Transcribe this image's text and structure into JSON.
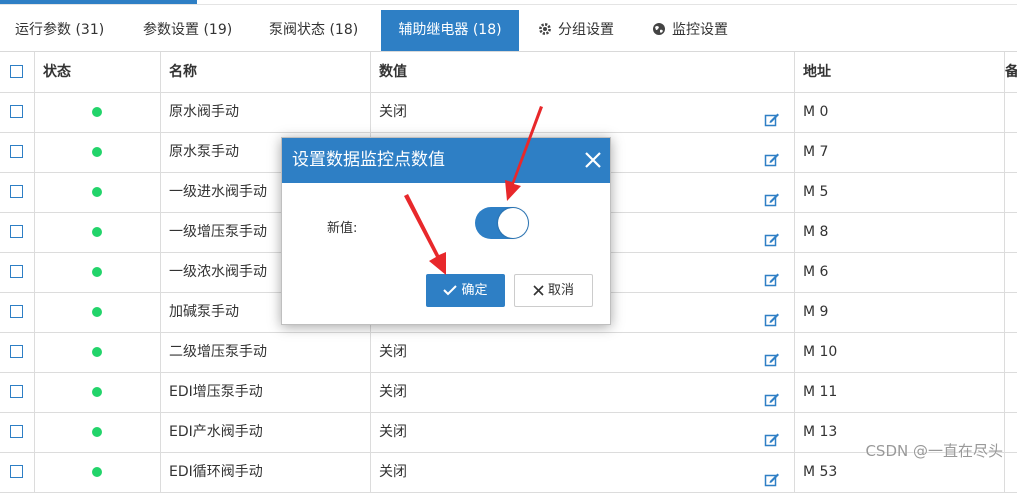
{
  "tabs": [
    {
      "label": "运行参数 (31)"
    },
    {
      "label": "参数设置 (19)"
    },
    {
      "label": "泵阀状态 (18)"
    },
    {
      "label": "辅助继电器 (18)"
    },
    {
      "label": "分组设置",
      "icon": "gear-icon"
    },
    {
      "label": "监控设置",
      "icon": "globe-icon"
    }
  ],
  "table": {
    "headers": {
      "status": "状态",
      "name": "名称",
      "value": "数值",
      "address": "地址",
      "extra": "备"
    },
    "rows": [
      {
        "name": "原水阀手动",
        "value": "关闭",
        "address": "M 0"
      },
      {
        "name": "原水泵手动",
        "value": "",
        "address": "M 7"
      },
      {
        "name": "一级进水阀手动",
        "value": "",
        "address": "M 5"
      },
      {
        "name": "一级增压泵手动",
        "value": "",
        "address": "M 8"
      },
      {
        "name": "一级浓水阀手动",
        "value": "",
        "address": "M 6"
      },
      {
        "name": "加碱泵手动",
        "value": "",
        "address": "M 9"
      },
      {
        "name": "二级增压泵手动",
        "value": "关闭",
        "address": "M 10"
      },
      {
        "name": "EDI增压泵手动",
        "value": "关闭",
        "address": "M 11"
      },
      {
        "name": "EDI产水阀手动",
        "value": "关闭",
        "address": "M 13"
      },
      {
        "name": "EDI循环阀手动",
        "value": "关闭",
        "address": "M 53"
      }
    ]
  },
  "modal": {
    "title": "设置数据监控点数值",
    "field_label": "新值:",
    "toggle_on": true,
    "ok_label": "确定",
    "cancel_label": "取消"
  },
  "watermark": "CSDN @一直在尽头",
  "colors": {
    "accent": "#2e7fc5",
    "status_dot": "#22d46a",
    "arrow": "#e8282b"
  }
}
